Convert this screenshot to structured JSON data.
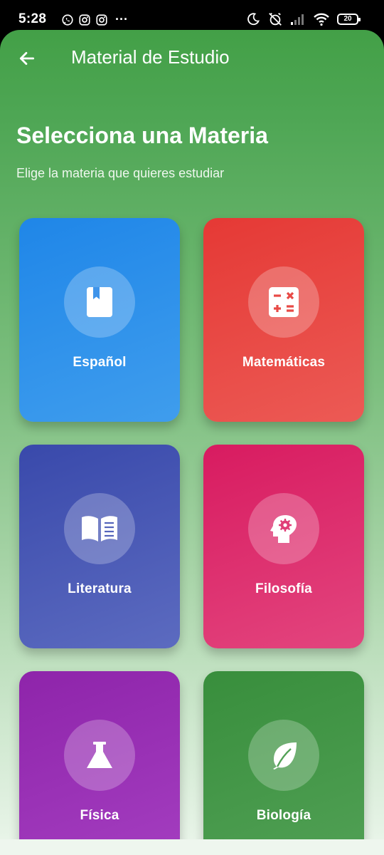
{
  "status_bar": {
    "time": "5:28",
    "more": "···",
    "battery": "20"
  },
  "app_bar": {
    "title": "Material de Estudio"
  },
  "page": {
    "heading": "Selecciona una Materia",
    "subheading": "Elige la materia que quieres estudiar"
  },
  "subjects": [
    {
      "label": "Español",
      "icon": "book-icon",
      "color": "#1f86e8"
    },
    {
      "label": "Matemáticas",
      "icon": "calculator-icon",
      "color": "#e53935"
    },
    {
      "label": "Literatura",
      "icon": "open-book-icon",
      "color": "#3949ab"
    },
    {
      "label": "Filosofía",
      "icon": "psychology-icon",
      "color": "#d81b60"
    },
    {
      "label": "Física",
      "icon": "flask-icon",
      "color": "#8e24aa"
    },
    {
      "label": "Biología",
      "icon": "leaf-icon",
      "color": "#388e3c"
    }
  ]
}
